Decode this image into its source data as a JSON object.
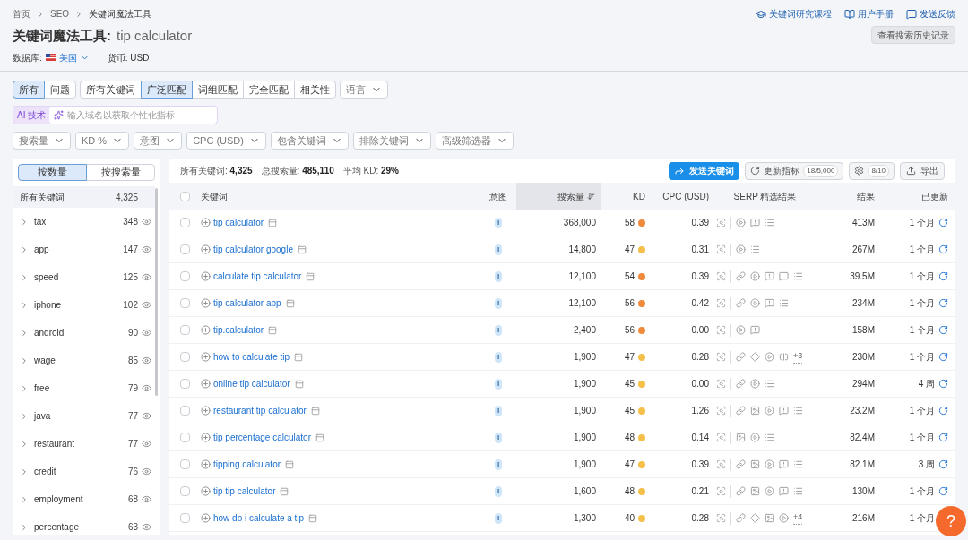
{
  "breadcrumb": [
    "首页",
    "SEO",
    "关键词魔法工具"
  ],
  "title": {
    "tool": "关键词魔法工具:",
    "query": "tip calculator"
  },
  "database": {
    "label": "数据库:",
    "country": "美国"
  },
  "currency": "货币: USD",
  "top_links": [
    {
      "kind": "course",
      "label": "关键词研究课程"
    },
    {
      "kind": "manual",
      "label": "用户手册"
    },
    {
      "kind": "feedback",
      "label": "发送反馈"
    }
  ],
  "history_button": "查看搜索历史记录",
  "type_tabs": [
    {
      "label": "所有",
      "selected": true
    },
    {
      "label": "问题",
      "selected": false
    }
  ],
  "match_tabs": [
    {
      "label": "所有关键词",
      "selected": false
    },
    {
      "label": "广泛匹配",
      "selected": true
    },
    {
      "label": "词组匹配",
      "selected": false
    },
    {
      "label": "完全匹配",
      "selected": false
    },
    {
      "label": "相关性",
      "selected": false
    }
  ],
  "language_dropdown": "语言",
  "ai": {
    "badge": "AI 技术",
    "placeholder": "输入域名以获取个性化指标"
  },
  "filters": [
    "搜索量",
    "KD %",
    "意图",
    "CPC (USD)",
    "包含关键词",
    "排除关键词",
    "高级筛选器"
  ],
  "group_tabs": [
    {
      "label": "按数量",
      "selected": true
    },
    {
      "label": "按搜索量",
      "selected": false
    }
  ],
  "groups": [
    {
      "label": "所有关键词",
      "count": "4,325",
      "selected": true
    },
    {
      "label": "tax",
      "count": "348",
      "selected": false
    },
    {
      "label": "app",
      "count": "147",
      "selected": false
    },
    {
      "label": "speed",
      "count": "125",
      "selected": false
    },
    {
      "label": "iphone",
      "count": "102",
      "selected": false
    },
    {
      "label": "android",
      "count": "90",
      "selected": false
    },
    {
      "label": "wage",
      "count": "85",
      "selected": false
    },
    {
      "label": "free",
      "count": "79",
      "selected": false
    },
    {
      "label": "java",
      "count": "77",
      "selected": false
    },
    {
      "label": "restaurant",
      "count": "77",
      "selected": false
    },
    {
      "label": "credit",
      "count": "76",
      "selected": false
    },
    {
      "label": "employment",
      "count": "68",
      "selected": false
    },
    {
      "label": "percentage",
      "count": "63",
      "selected": false
    }
  ],
  "summary": [
    {
      "label": "所有关键词:",
      "value": "4,325"
    },
    {
      "label": "总搜索量:",
      "value": "485,110"
    },
    {
      "label": "平均 KD:",
      "value": "29%"
    }
  ],
  "actions": {
    "send": "发送关键词",
    "update": "更新指标",
    "update_count": "18/5,000",
    "settings_count": "8/10",
    "export": "导出"
  },
  "select_all": {
    "checked": false
  },
  "columns": [
    "关键词",
    "意图",
    "搜索量",
    "KD",
    "CPC (USD)",
    "SERP 精选结果",
    "结果",
    "已更新"
  ],
  "rows": [
    {
      "checked": false,
      "keyword": "tip calculator",
      "intent": "I",
      "volume": "368,000",
      "kd": "58",
      "color": "#f08a3c",
      "cpc": "0.39",
      "serp": [
        {
          "kind": "video"
        },
        {
          "kind": "faq"
        },
        {
          "kind": "list"
        }
      ],
      "results": "413M",
      "updated": "1 个月"
    },
    {
      "checked": false,
      "keyword": "tip calculator google",
      "intent": "I",
      "volume": "14,800",
      "kd": "47",
      "color": "#f5c04a",
      "cpc": "0.31",
      "serp": [
        {
          "kind": "video"
        },
        {
          "kind": "list"
        }
      ],
      "results": "267M",
      "updated": "1 个月"
    },
    {
      "checked": false,
      "keyword": "calculate tip calculator",
      "intent": "I",
      "volume": "12,100",
      "kd": "54",
      "color": "#f08a3c",
      "cpc": "0.39",
      "serp": [
        {
          "kind": "link"
        },
        {
          "kind": "video"
        },
        {
          "kind": "faq"
        },
        {
          "kind": "comment"
        },
        {
          "kind": "list"
        }
      ],
      "results": "39.5M",
      "updated": "1 个月"
    },
    {
      "checked": false,
      "keyword": "tip calculator app",
      "intent": "I",
      "volume": "12,100",
      "kd": "56",
      "color": "#f08a3c",
      "cpc": "0.42",
      "serp": [
        {
          "kind": "link"
        },
        {
          "kind": "video"
        },
        {
          "kind": "faq"
        },
        {
          "kind": "list"
        }
      ],
      "results": "234M",
      "updated": "1 个月"
    },
    {
      "checked": false,
      "keyword": "tip.calculator",
      "intent": "I",
      "volume": "2,400",
      "kd": "56",
      "color": "#f08a3c",
      "cpc": "0.00",
      "serp": [
        {
          "kind": "video"
        },
        {
          "kind": "faq"
        }
      ],
      "results": "158M",
      "updated": "1 个月"
    },
    {
      "checked": false,
      "keyword": "how to calculate tip",
      "intent": "I",
      "volume": "1,900",
      "kd": "47",
      "color": "#f5c04a",
      "cpc": "0.28",
      "serp": [
        {
          "kind": "link"
        },
        {
          "kind": "diamond"
        },
        {
          "kind": "video"
        },
        {
          "kind": "frame"
        },
        {
          "kind": "more",
          "text": "+3"
        }
      ],
      "results": "230M",
      "updated": "1 个月"
    },
    {
      "checked": false,
      "keyword": "online tip calculator",
      "intent": "I",
      "volume": "1,900",
      "kd": "45",
      "color": "#f5c04a",
      "cpc": "0.00",
      "serp": [
        {
          "kind": "link"
        },
        {
          "kind": "video"
        },
        {
          "kind": "list"
        }
      ],
      "results": "294M",
      "updated": "4 周"
    },
    {
      "checked": false,
      "keyword": "restaurant tip calculator",
      "intent": "I",
      "volume": "1,900",
      "kd": "45",
      "color": "#f5c04a",
      "cpc": "1.26",
      "serp": [
        {
          "kind": "link"
        },
        {
          "kind": "image"
        },
        {
          "kind": "video"
        },
        {
          "kind": "faq"
        },
        {
          "kind": "list"
        }
      ],
      "results": "23.2M",
      "updated": "1 个月"
    },
    {
      "checked": false,
      "keyword": "tip percentage calculator",
      "intent": "I",
      "volume": "1,900",
      "kd": "48",
      "color": "#f5c04a",
      "cpc": "0.14",
      "serp": [
        {
          "kind": "image"
        },
        {
          "kind": "video"
        },
        {
          "kind": "list"
        }
      ],
      "results": "82.4M",
      "updated": "1 个月"
    },
    {
      "checked": false,
      "keyword": "tipping calculator",
      "intent": "I",
      "volume": "1,900",
      "kd": "47",
      "color": "#f5c04a",
      "cpc": "0.39",
      "serp": [
        {
          "kind": "link"
        },
        {
          "kind": "image"
        },
        {
          "kind": "video"
        },
        {
          "kind": "faq"
        },
        {
          "kind": "list"
        }
      ],
      "results": "82.1M",
      "updated": "3 周"
    },
    {
      "checked": false,
      "keyword": "tip tip calculator",
      "intent": "I",
      "volume": "1,600",
      "kd": "48",
      "color": "#f5c04a",
      "cpc": "0.21",
      "serp": [
        {
          "kind": "link"
        },
        {
          "kind": "image"
        },
        {
          "kind": "video"
        },
        {
          "kind": "faq"
        },
        {
          "kind": "list"
        }
      ],
      "results": "130M",
      "updated": "1 个月"
    },
    {
      "checked": false,
      "keyword": "how do i calculate a tip",
      "intent": "I",
      "volume": "1,300",
      "kd": "40",
      "color": "#f5c04a",
      "cpc": "0.28",
      "serp": [
        {
          "kind": "link"
        },
        {
          "kind": "diamond"
        },
        {
          "kind": "image"
        },
        {
          "kind": "video"
        },
        {
          "kind": "more",
          "text": "+4"
        }
      ],
      "results": "216M",
      "updated": "1 个月"
    }
  ],
  "help_button": "?"
}
